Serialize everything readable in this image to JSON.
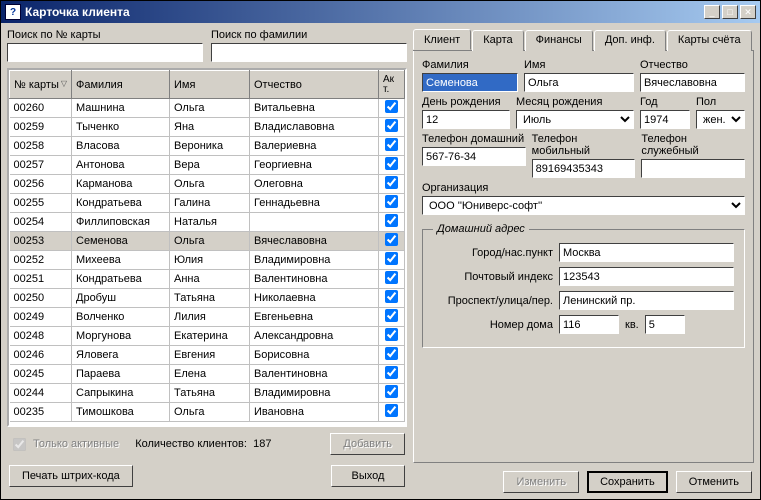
{
  "window": {
    "title": "Карточка клиента"
  },
  "search": {
    "card_label": "Поиск по № карты",
    "card_value": "",
    "surname_label": "Поиск по фамилии",
    "surname_value": ""
  },
  "table": {
    "headers": {
      "card": "№ карты",
      "surname": "Фамилия",
      "name": "Имя",
      "patronymic": "Отчество",
      "active": "Ак\nт."
    },
    "rows": [
      {
        "card": "00260",
        "surname": "Машнина",
        "name": "Ольга",
        "patronymic": "Витальевна",
        "active": true
      },
      {
        "card": "00259",
        "surname": "Тыченко",
        "name": "Яна",
        "patronymic": "Владиславовна",
        "active": true
      },
      {
        "card": "00258",
        "surname": "Власова",
        "name": "Вероника",
        "patronymic": "Валериевна",
        "active": true
      },
      {
        "card": "00257",
        "surname": "Антонова",
        "name": "Вера",
        "patronymic": "Георгиевна",
        "active": true
      },
      {
        "card": "00256",
        "surname": "Карманова",
        "name": "Ольга",
        "patronymic": "Олеговна",
        "active": true
      },
      {
        "card": "00255",
        "surname": "Кондратьева",
        "name": "Галина",
        "patronymic": "Геннадьевна",
        "active": true
      },
      {
        "card": "00254",
        "surname": "Филлиповская",
        "name": "Наталья",
        "patronymic": "",
        "active": true
      },
      {
        "card": "00253",
        "surname": "Семенова",
        "name": "Ольга",
        "patronymic": "Вячеславовна",
        "active": true,
        "selected": true
      },
      {
        "card": "00252",
        "surname": "Михеева",
        "name": "Юлия",
        "patronymic": "Владимировна",
        "active": true
      },
      {
        "card": "00251",
        "surname": "Кондратьева",
        "name": "Анна",
        "patronymic": "Валентиновна",
        "active": true
      },
      {
        "card": "00250",
        "surname": "Дробуш",
        "name": "Татьяна",
        "patronymic": "Николаевна",
        "active": true
      },
      {
        "card": "00249",
        "surname": "Волченко",
        "name": "Лилия",
        "patronymic": "Евгеньевна",
        "active": true
      },
      {
        "card": "00248",
        "surname": "Моргунова",
        "name": "Екатерина",
        "patronymic": "Александровна",
        "active": true
      },
      {
        "card": "00246",
        "surname": "Яловега",
        "name": "Евгения",
        "patronymic": "Борисовна",
        "active": true
      },
      {
        "card": "00245",
        "surname": "Параева",
        "name": "Елена",
        "patronymic": "Валентиновна",
        "active": true
      },
      {
        "card": "00244",
        "surname": "Сапрыкина",
        "name": "Татьяна",
        "patronymic": "Владимировна",
        "active": true
      },
      {
        "card": "00235",
        "surname": "Тимошкова",
        "name": "Ольга",
        "patronymic": "Ивановна",
        "active": true
      }
    ]
  },
  "left_footer": {
    "only_active": "Только активные",
    "count_label": "Количество клиентов:",
    "count_value": "187",
    "add": "Добавить",
    "barcode": "Печать штрих-кода"
  },
  "tabs": {
    "items": [
      {
        "label": "Клиент",
        "active": true
      },
      {
        "label": "Карта"
      },
      {
        "label": "Финансы"
      },
      {
        "label": "Доп. инф."
      },
      {
        "label": "Карты счёта"
      }
    ]
  },
  "client": {
    "surname_label": "Фамилия",
    "surname": "Семенова",
    "name_label": "Имя",
    "name": "Ольга",
    "patronymic_label": "Отчество",
    "patronymic": "Вячеславовна",
    "bday_label": "День рождения",
    "bday": "12",
    "bmonth_label": "Месяц рождения",
    "bmonth": "Июль",
    "byear_label": "Год",
    "byear": "1974",
    "sex_label": "Пол",
    "sex": "жен.",
    "phone_home_label": "Телефон домашний",
    "phone_home": "567-76-34",
    "phone_mob_label": "Телефон мобильный",
    "phone_mob": "89169435343",
    "phone_work_label": "Телефон служебный",
    "phone_work": "",
    "org_label": "Организация",
    "org": "ООО ''Юниверс-софт''",
    "address": {
      "legend": "Домашний адрес",
      "city_label": "Город/нас.пункт",
      "city": "Москва",
      "zip_label": "Почтовый индекс",
      "zip": "123543",
      "street_label": "Проспект/улица/пер.",
      "street": "Ленинский пр.",
      "house_label": "Номер дома",
      "house": "116",
      "apt_label": "кв.",
      "apt": "5"
    }
  },
  "right_footer": {
    "edit": "Изменить",
    "save": "Сохранить",
    "cancel": "Отменить",
    "exit": "Выход"
  }
}
